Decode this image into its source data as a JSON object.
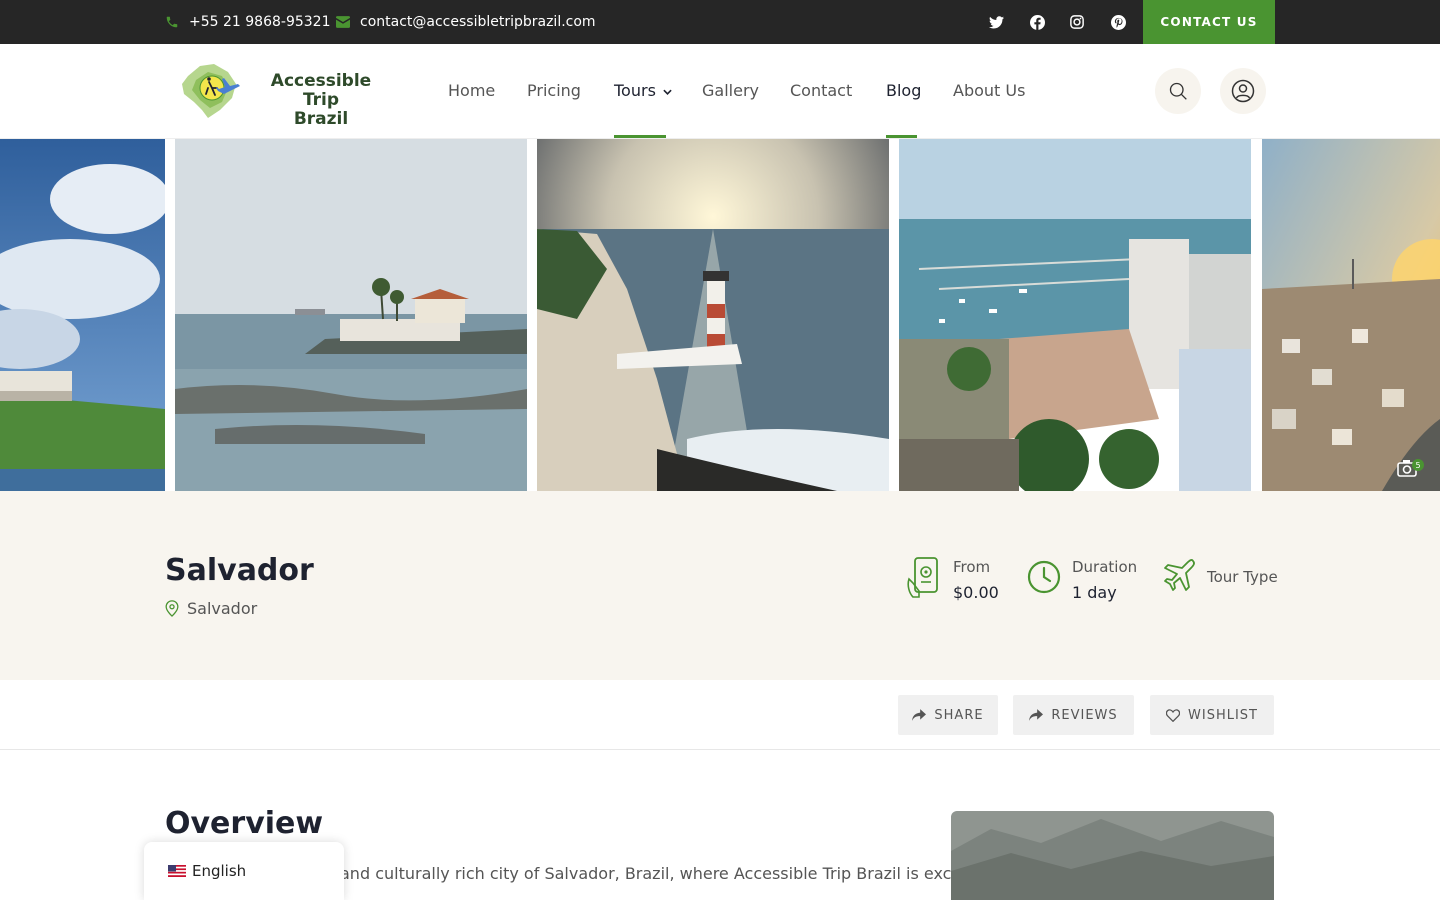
{
  "topbar": {
    "phone": "+55 21 9868-95321",
    "email": "contact@accessibletripbrazil.com",
    "social": [
      "twitter-icon",
      "facebook-icon",
      "instagram-icon",
      "pinterest-icon"
    ],
    "contact_button": "CONTACT US"
  },
  "header": {
    "logo_line1": "Accessible Trip",
    "logo_line2": "Brazil",
    "nav": [
      {
        "label": "Home"
      },
      {
        "label": "Pricing"
      },
      {
        "label": "Tours"
      },
      {
        "label": "Gallery"
      },
      {
        "label": "Contact"
      },
      {
        "label": "Blog"
      },
      {
        "label": "About Us"
      }
    ]
  },
  "gallery": {
    "photo_count": "5"
  },
  "tour": {
    "title": "Salvador",
    "location": "Salvador",
    "from_label": "From",
    "from_value": "$0.00",
    "duration_label": "Duration",
    "duration_value": "1 day",
    "type_label": "Tour Type"
  },
  "actions": {
    "share": "SHARE",
    "reviews": "REVIEWS",
    "wishlist": "WISHLIST"
  },
  "overview": {
    "title": "Overview",
    "text": "and culturally rich city of Salvador, Brazil, where Accessible Trip Brazil is excited"
  },
  "language": {
    "selected": "English"
  },
  "colors": {
    "accent": "#4a9431",
    "dark": "#262626",
    "band": "#f8f5ef"
  }
}
